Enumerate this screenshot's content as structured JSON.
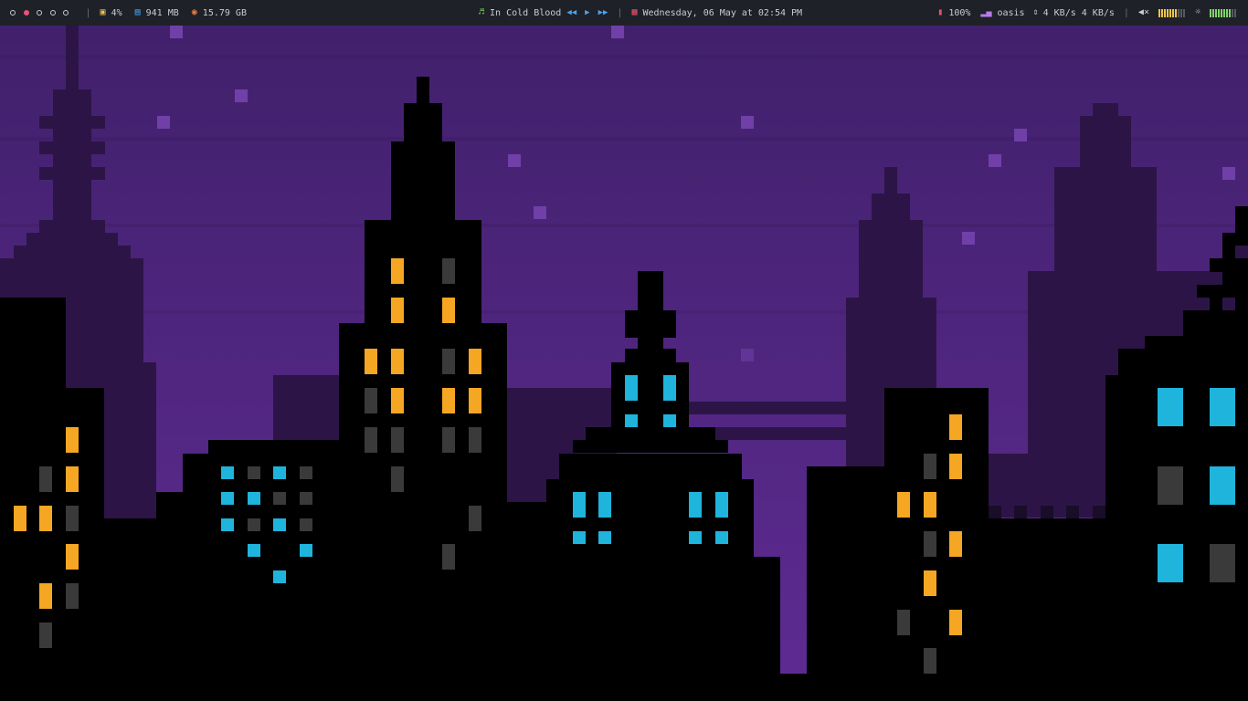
{
  "colors": {
    "bar_bg": "#1e2127",
    "bar_text": "#c8ccd4",
    "accent_pink": "#e8537a",
    "accent_yellow": "#f0c24a",
    "accent_blue": "#4aa3f0",
    "accent_orange": "#f07c3a",
    "accent_green": "#7fd36b",
    "accent_red": "#e8536a",
    "accent_purple": "#b67ce8",
    "sky_top": "#43206b",
    "sky_bottom": "#5a2a8e",
    "window_amber": "#f5a623",
    "window_cyan": "#1fb4dc",
    "window_off": "#3a3a3a"
  },
  "workspaces": [
    {
      "index": 1,
      "active": false
    },
    {
      "index": 2,
      "active": true
    },
    {
      "index": 3,
      "active": false
    },
    {
      "index": 4,
      "active": false
    },
    {
      "index": 5,
      "active": false
    }
  ],
  "stats": {
    "cpu": {
      "icon": "cpu-icon",
      "text": "4%"
    },
    "memory": {
      "icon": "memory-icon",
      "text": "941 MB"
    },
    "filesystem": {
      "icon": "disk-icon",
      "text": "15.79 GB"
    }
  },
  "music": {
    "icon": "music-note-icon",
    "track": "In Cold Blood",
    "controls": [
      "previous-icon",
      "play-icon",
      "next-icon"
    ]
  },
  "clock": {
    "icon": "calendar-icon",
    "text": "Wednesday, 06 May at 02:54 PM"
  },
  "battery": {
    "icon": "battery-icon",
    "text": "100%"
  },
  "network": {
    "icon": "wifi-signal-icon",
    "ssid": "oasis",
    "updown_icon": "up-down-arrows-icon",
    "rate": "4 KB/s 4 KB/s"
  },
  "volume": {
    "icon": "speaker-mute-icon",
    "level": 0.7
  },
  "brightness": {
    "icon": "brightness-icon",
    "level": 0.8
  },
  "separator": "|"
}
